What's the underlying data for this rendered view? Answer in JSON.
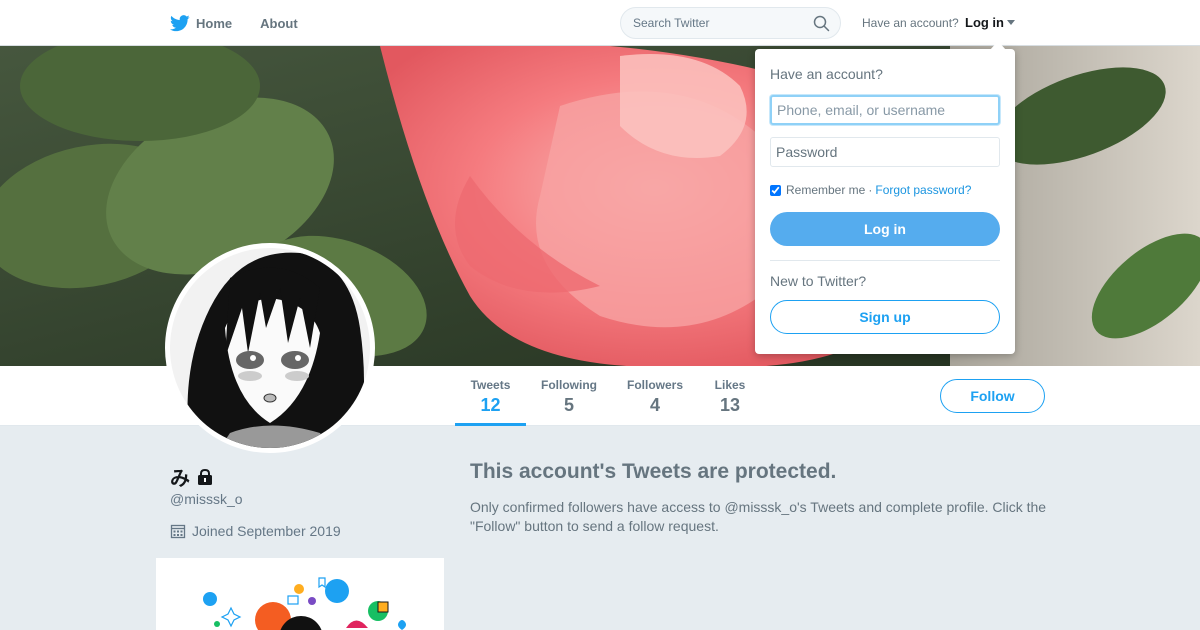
{
  "topbar": {
    "home_label": "Home",
    "about_label": "About",
    "search_placeholder": "Search Twitter",
    "account_prompt": "Have an account?",
    "login_label": "Log in"
  },
  "login_dropdown": {
    "heading": "Have an account?",
    "username_placeholder": "Phone, email, or username",
    "password_placeholder": "Password",
    "remember_label": "Remember me",
    "separator": "·",
    "forgot_label": "Forgot password?",
    "login_button": "Log in",
    "new_prompt": "New to Twitter?",
    "signup_button": "Sign up"
  },
  "profile": {
    "name": "み",
    "handle": "@misssk_o",
    "joined": "Joined September 2019"
  },
  "stats": [
    {
      "label": "Tweets",
      "value": "12"
    },
    {
      "label": "Following",
      "value": "5"
    },
    {
      "label": "Followers",
      "value": "4"
    },
    {
      "label": "Likes",
      "value": "13"
    }
  ],
  "follow_label": "Follow",
  "protected": {
    "title": "This account's Tweets are protected.",
    "body": "Only confirmed followers have access to @misssk_o's Tweets and complete profile. Click the \"Follow\" button to send a follow request."
  },
  "colors": {
    "brand_blue": "#1da1f2",
    "login_button": "#55acee",
    "page_background": "#e6ecf0",
    "muted_text": "#66757f"
  },
  "icons": {
    "logo": "twitter-bird-icon",
    "search": "search-icon",
    "lock": "lock-icon",
    "calendar": "calendar-icon"
  }
}
